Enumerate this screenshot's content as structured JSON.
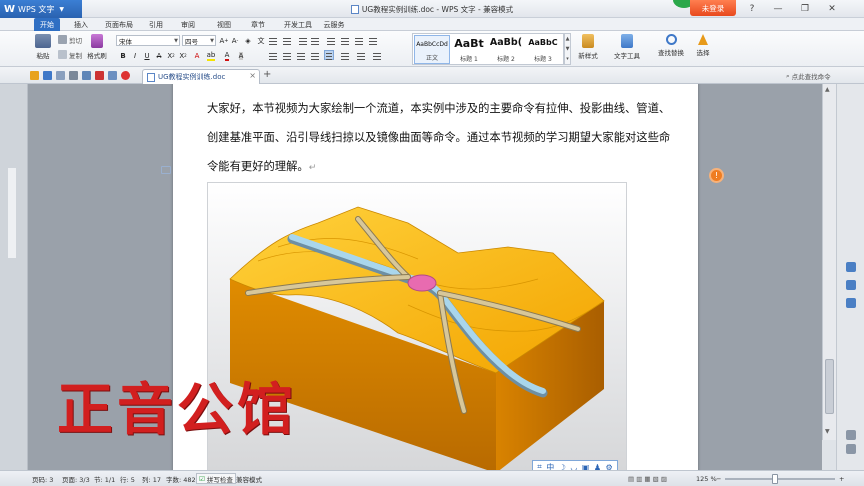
{
  "app": {
    "brand": "WPS 文字",
    "logo": "W",
    "window_title": "UG教程实例训练.doc - WPS 文字 - 兼容模式",
    "login_label": "未登录"
  },
  "window_controls": [
    "?",
    "—",
    "❐",
    "✕"
  ],
  "menu_tabs": [
    "开始",
    "插入",
    "页面布局",
    "引用",
    "审阅",
    "视图",
    "章节",
    "开发工具",
    "云服务"
  ],
  "ribbon": {
    "paste_label": "粘贴",
    "cut_label": "剪切",
    "copy_label": "复制",
    "format_painter_label": "格式刷",
    "font_name": "宋体",
    "font_size": "四号",
    "styles": [
      {
        "sample": "AaBbCcDd",
        "name": "正文"
      },
      {
        "sample": "AaBt",
        "name": "标题 1"
      },
      {
        "sample": "AaBb(",
        "name": "标题 2"
      },
      {
        "sample": "AaBbC",
        "name": "标题 3"
      }
    ],
    "new_style_label": "新样式",
    "text_tools_label": "文字工具",
    "find_replace_label": "查找替换",
    "select_label": "选择"
  },
  "doc_tab": {
    "name": "UG教程实例训练.doc",
    "close": "×",
    "add": "+"
  },
  "right_link": "点此查找命令",
  "document": {
    "paragraph": "大家好，本节视频为大家绘制一个流道，本实例中涉及的主要命令有拉伸、投影曲线、管道、创建基准平面、沿引导线扫掠以及镜像曲面等命令。通过本节视频的学习期望大家能对这些命令能有更好的理解。",
    "paragraph_mark": "↵",
    "comment_marker": "!"
  },
  "watermark": "正音公馆",
  "ime_bar": [
    "⌗",
    "中",
    "☽",
    "◡",
    "▣",
    "♟",
    "⚙"
  ],
  "status": {
    "page": "页码: 3",
    "pages": "页面: 3/3",
    "section": "节: 1/1",
    "row": "行: 5",
    "column": "列: 17",
    "word_count": "字数: 482",
    "spell_check": "拼写检查",
    "compat_mode": "兼容模式",
    "zoom_level": "125 %",
    "zoom_minus": "−",
    "zoom_plus": "+"
  },
  "colors": {
    "accent": "#2f6fc3",
    "watermark": "#d21f1f",
    "model_orange": "#f5a900",
    "channel_blue": "#a9d6ec"
  }
}
